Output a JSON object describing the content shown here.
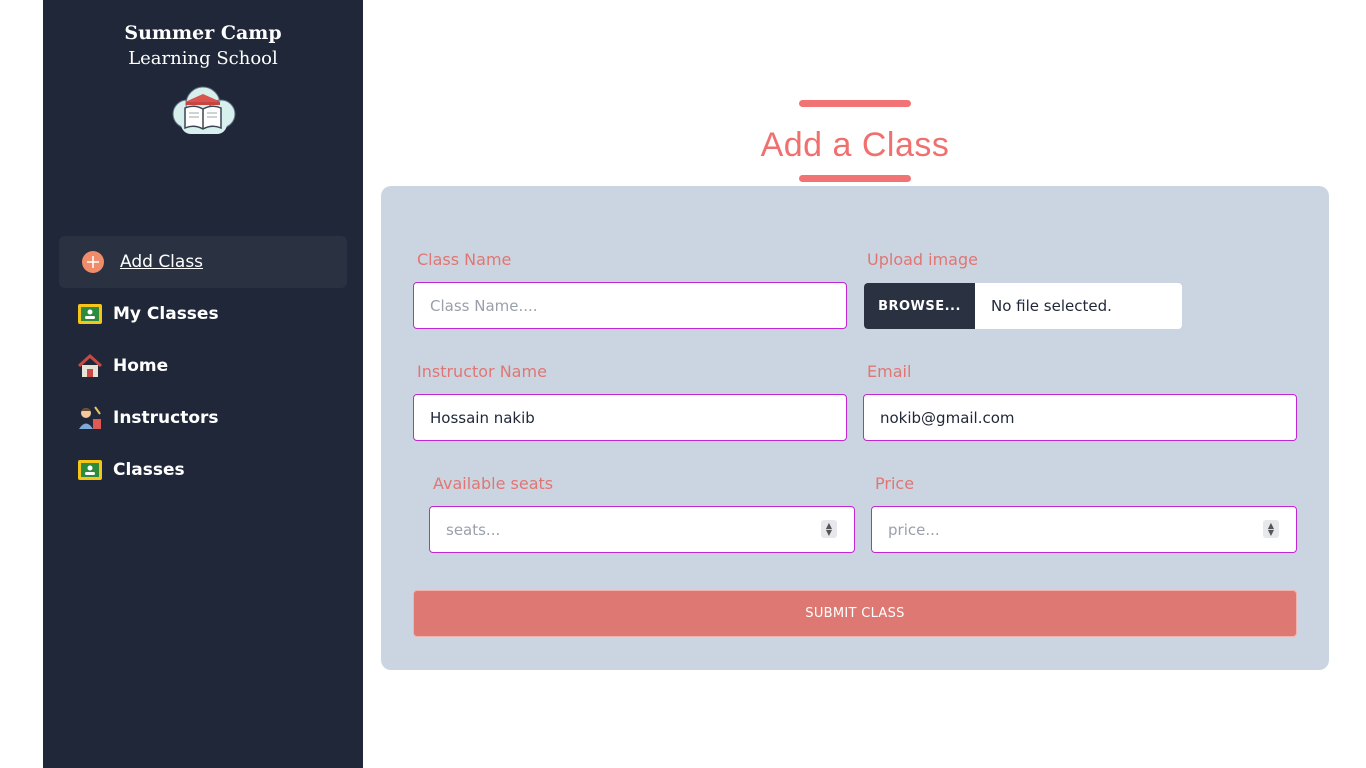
{
  "brand": {
    "title": "Summer Camp",
    "subtitle": "Learning School",
    "logo_icon": "book-cloud-logo"
  },
  "sidebar": {
    "items": [
      {
        "label": "Add Class",
        "icon": "plus-circle-icon",
        "active": true
      },
      {
        "label": "My Classes",
        "icon": "classroom-board-icon"
      },
      {
        "label": "Home",
        "icon": "house-icon"
      },
      {
        "label": "Instructors",
        "icon": "teacher-icon"
      },
      {
        "label": "Classes",
        "icon": "classroom-board-icon"
      }
    ]
  },
  "main": {
    "heading": "Add a Class",
    "form": {
      "class_name": {
        "label": "Class Name",
        "value": "",
        "placeholder": "Class Name...."
      },
      "upload": {
        "label": "Upload image",
        "button": "BROWSE...",
        "status": "No file selected."
      },
      "instructor": {
        "label": "Instructor Name",
        "value": "Hossain nakib"
      },
      "email": {
        "label": "Email",
        "value": "nokib@gmail.com"
      },
      "seats": {
        "label": "Available seats",
        "value": "",
        "placeholder": "seats..."
      },
      "price": {
        "label": "Price",
        "value": "",
        "placeholder": "price..."
      },
      "submit": "SUBMIT CLASS"
    }
  },
  "colors": {
    "sidebar": "#1f2738",
    "accent": "#f17373",
    "card": "#cbd5e1",
    "input_border": "#c026d3"
  }
}
